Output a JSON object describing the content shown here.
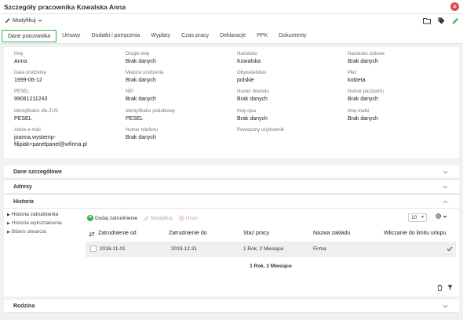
{
  "window": {
    "title": "Szczegóły pracownika Kowalska Anna"
  },
  "toolbar": {
    "modify_label": "Modyfikuj"
  },
  "tabs": [
    "Dane pracownika",
    "Umowy",
    "Dodatki i potrącenia",
    "Wypłaty",
    "Czas pracy",
    "Deklaracje",
    "PPK",
    "Dokumenty"
  ],
  "details": {
    "imie": {
      "label": "Imię",
      "value": "Anna"
    },
    "drugie_imie": {
      "label": "Drugie imię",
      "value": "Brak danych"
    },
    "nazwisko": {
      "label": "Nazwisko",
      "value": "Kowalska"
    },
    "nazwisko_rodowe": {
      "label": "Nazwisko rodowe",
      "value": "Brak danych"
    },
    "data_urodzenia": {
      "label": "Data urodzenia",
      "value": "1999-06-12"
    },
    "miejsce_urodzenia": {
      "label": "Miejsce urodzenia",
      "value": "Brak danych"
    },
    "obywatelstwo": {
      "label": "Obywatelstwo",
      "value": "polskie"
    },
    "plec": {
      "label": "Płeć",
      "value": "kobieta"
    },
    "pesel": {
      "label": "PESEL",
      "value": "99061211243"
    },
    "nip": {
      "label": "NIP",
      "value": "Brak danych"
    },
    "numer_dowodu": {
      "label": "Numer dowodu",
      "value": "Brak danych"
    },
    "numer_paszportu": {
      "label": "Numer paszportu",
      "value": "Brak danych"
    },
    "id_zus": {
      "label": "Identyfikator dla ZUS",
      "value": "PESEL"
    },
    "id_podatkowy": {
      "label": "Identyfikator podatkowy",
      "value": "PESEL"
    },
    "imie_ojca": {
      "label": "Imię ojca",
      "value": "Brak danych"
    },
    "imie_matki": {
      "label": "Imię matki",
      "value": "Brak danych"
    },
    "email": {
      "label": "Adres e-mail",
      "value_line1": "joanna.wystemp-",
      "value_line2": "filipiak+panelpanel@wfirma.pl"
    },
    "telefon": {
      "label": "Numer telefonu",
      "value": "Brak danych"
    },
    "uzytkownik": {
      "label": "Powiązany użytkownik"
    }
  },
  "sections": {
    "dane_szczegolowe": "Dane szczegółowe",
    "adresy": "Adresy",
    "historia": "Historia",
    "rodzina": "Rodzina"
  },
  "history": {
    "nav": [
      "Historia zatrudnienia",
      "Historia wykształcenia",
      "Bilans otwarcia"
    ],
    "actions": {
      "add": "Dodaj zatrudnienie",
      "modify": "Modyfikuj",
      "delete": "Usuń"
    },
    "page_size": "10",
    "columns": [
      "Zatrudnienie od",
      "Zatrudnienie do",
      "Staż pracy",
      "Nazwa zakładu",
      "Wliczanie do limitu urlopu"
    ],
    "rows": [
      {
        "from": "2018-11-01",
        "to": "2019-12-31",
        "duration": "1 Rok, 2 Miesiące",
        "company": "Firma"
      }
    ],
    "summary": "1 Rok, 2 Miesiące"
  },
  "colors": {
    "accent_green": "#32b04a",
    "close_red": "#e24b4b"
  }
}
